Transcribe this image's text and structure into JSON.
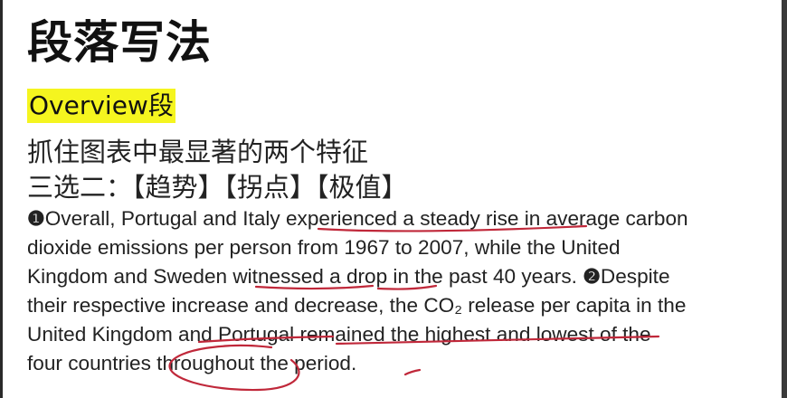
{
  "slide": {
    "title": "段落写法",
    "subhead": "Overview段",
    "line1": "抓住图表中最显著的两个特征",
    "line2": "三选二：【趋势】【拐点】【极值】",
    "paragraph": {
      "rows": [
        [
          "❶",
          "Overall, Portugal and Italy experienced a steady rise in average carbon"
        ],
        [
          "",
          "dioxide emissions per person from 1967 to 2007, while the United"
        ],
        [
          "",
          "Kingdom and Sweden witnessed a drop in the past 40 years. "
        ],
        [
          "",
          "their respective increase and decrease, the CO₂ release per capita in the"
        ],
        [
          "",
          "United Kingdom and Portugal remained the highest and lowest of the"
        ],
        [
          "",
          "four countries throughout the period."
        ]
      ],
      "row3_marker": "❷",
      "row3_tail": "Despite"
    }
  },
  "colors": {
    "highlight": "#f5f51f",
    "annotation": "#c0283a"
  }
}
